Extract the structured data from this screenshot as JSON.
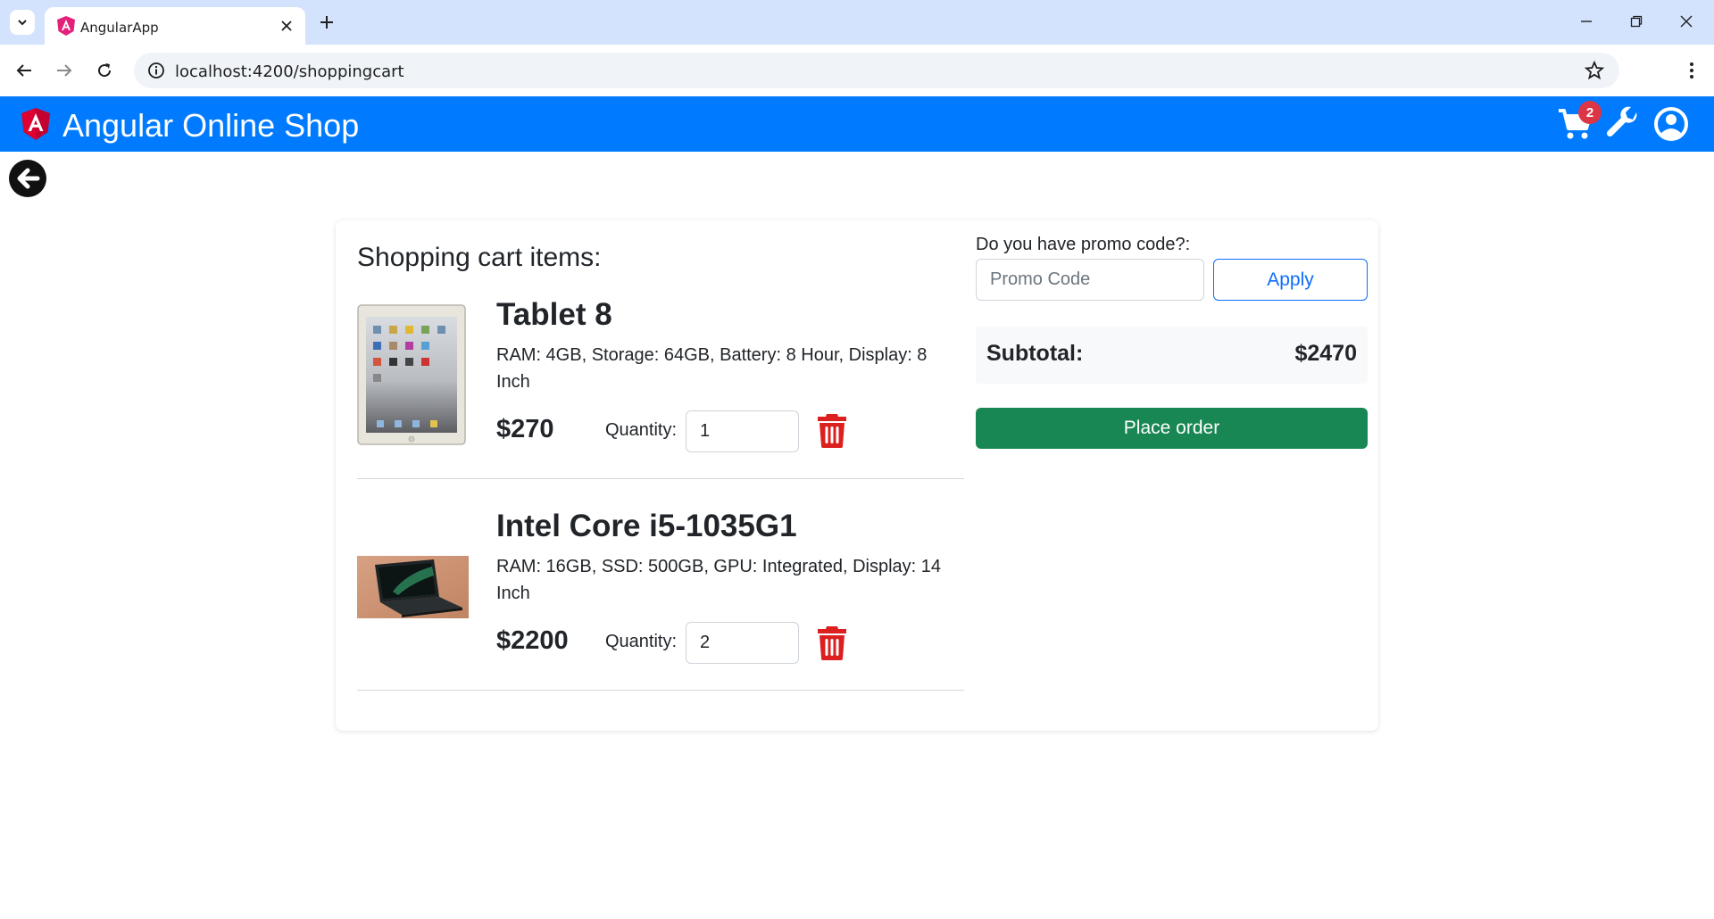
{
  "browser": {
    "tab_title": "AngularApp",
    "url": "localhost:4200/shoppingcart",
    "icons": [
      "tab-list-icon",
      "close-icon",
      "plus-icon",
      "minimize-icon",
      "restore-icon",
      "close-window-icon",
      "back-arrow-icon",
      "forward-arrow-icon",
      "reload-icon",
      "site-info-icon",
      "star-icon",
      "kebab-menu-icon"
    ]
  },
  "navbar": {
    "brand_title": "Angular Online Shop",
    "cart_count": "2",
    "bg_color": "#007bff",
    "icons": [
      "angular-logo-icon",
      "cart-icon",
      "wrench-icon",
      "user-circle-icon"
    ]
  },
  "cart": {
    "heading": "Shopping cart items:",
    "quantity_label": "Quantity:",
    "items": [
      {
        "name": "Tablet 8",
        "description": "RAM: 4GB, Storage: 64GB, Battery: 8 Hour, Display: 8 Inch",
        "price": "$270",
        "quantity": "1",
        "image": "tablet-image"
      },
      {
        "name": "Intel Core i5-1035G1",
        "description": "RAM: 16GB, SSD: 500GB, GPU: Integrated, Display: 14 Inch",
        "price": "$2200",
        "quantity": "2",
        "image": "laptop-image"
      }
    ]
  },
  "summary": {
    "promo_label": "Do you have promo code?:",
    "promo_placeholder": "Promo Code",
    "apply_label": "Apply",
    "subtotal_label": "Subtotal:",
    "subtotal_value": "$2470",
    "place_order_label": "Place order",
    "order_color": "#198754",
    "apply_color": "#0d6efd",
    "trash_color": "#dc1f1f"
  }
}
